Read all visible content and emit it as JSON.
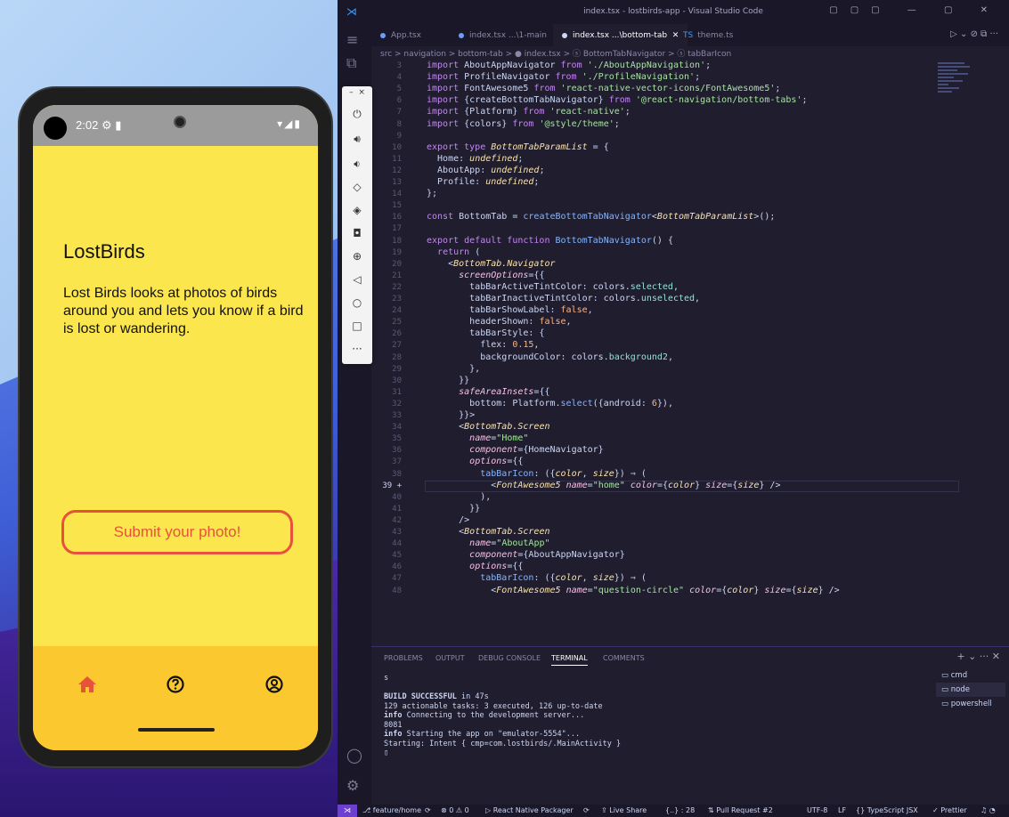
{
  "phone": {
    "status_time": "2:02",
    "status_icons": "⚙ ▮",
    "status_right": "▾◢▮",
    "app_title": "LostBirds",
    "app_description": "Lost Birds looks at photos of birds around you and lets you know if a bird is lost or wandering.",
    "submit_label": "Submit your photo!",
    "colors": {
      "background": "#fbe64d",
      "tabbar": "#fbc82f",
      "accent": "#e8513a"
    },
    "tabs": [
      {
        "icon": "home-icon",
        "active": true
      },
      {
        "icon": "question-circle-icon",
        "active": false
      },
      {
        "icon": "user-circle-icon",
        "active": false
      }
    ]
  },
  "vscode": {
    "window_title": "index.tsx - lostbirds-app - Visual Studio Code",
    "tabs": [
      {
        "label": "App.tsx"
      },
      {
        "label": "index.tsx ...\\1-main"
      },
      {
        "label": "index.tsx ...\\bottom-tab",
        "active": true
      },
      {
        "label": "theme.ts"
      }
    ],
    "breadcrumb": "src > navigation > bottom-tab > ● index.tsx > ⓢ BottomTabNavigator > ⓢ tabBarIcon",
    "code_lines": [
      {
        "n": "3",
        "html": "<span class='k'>import</span> AboutAppNavigator <span class='k'>from</span> <span class='s'>'./AboutAppNavigation'</span>;"
      },
      {
        "n": "4",
        "html": "<span class='k'>import</span> ProfileNavigator <span class='k'>from</span> <span class='s'>'./ProfileNavigation'</span>;"
      },
      {
        "n": "5",
        "html": "<span class='k'>import</span> FontAwesome5 <span class='k'>from</span> <span class='s'>'react-native-vector-icons/FontAwesome5'</span>;"
      },
      {
        "n": "6",
        "html": "<span class='k'>import</span> {createBottomTabNavigator} <span class='k'>from</span> <span class='s'>'@react-navigation/bottom-tabs'</span>;"
      },
      {
        "n": "7",
        "html": "<span class='k'>import</span> {Platform} <span class='k'>from</span> <span class='s'>'react-native'</span>;"
      },
      {
        "n": "8",
        "html": "<span class='k'>import</span> {colors} <span class='k'>from</span> <span class='s'>'@style/theme'</span>;"
      },
      {
        "n": "9",
        "html": ""
      },
      {
        "n": "10",
        "html": "<span class='k'>export type</span> <span class='t'>BottomTabParamList</span> = {"
      },
      {
        "n": "11",
        "html": "  Home: <span class='t'>undefined</span>;"
      },
      {
        "n": "12",
        "html": "  AboutApp: <span class='t'>undefined</span>;"
      },
      {
        "n": "13",
        "html": "  Profile: <span class='t'>undefined</span>;"
      },
      {
        "n": "14",
        "html": "};"
      },
      {
        "n": "15",
        "html": ""
      },
      {
        "n": "16",
        "html": "<span class='k'>const</span> BottomTab = <span class='f'>createBottomTabNavigator</span>&lt;<span class='t'>BottomTabParamList</span>&gt;();"
      },
      {
        "n": "17",
        "html": ""
      },
      {
        "n": "18",
        "html": "<span class='k'>export default function</span> <span class='f'>BottomTabNavigator</span>() {"
      },
      {
        "n": "19",
        "html": "  <span class='k'>return</span> ("
      },
      {
        "n": "20",
        "html": "    &lt;<span class='t'>BottomTab.Navigator</span>"
      },
      {
        "n": "21",
        "html": "      <span class='a'>screenOptions</span>={{"
      },
      {
        "n": "22",
        "html": "        tabBarActiveTintColor: colors.<span class='c'>selected</span>,"
      },
      {
        "n": "23",
        "html": "        tabBarInactiveTintColor: colors.<span class='c'>unselected</span>,"
      },
      {
        "n": "24",
        "html": "        tabBarShowLabel: <span class='n'>false</span>,"
      },
      {
        "n": "25",
        "html": "        headerShown: <span class='n'>false</span>,"
      },
      {
        "n": "26",
        "html": "        tabBarStyle: {"
      },
      {
        "n": "27",
        "html": "          flex: <span class='n'>0.15</span>,"
      },
      {
        "n": "28",
        "html": "          backgroundColor: colors.<span class='c'>background2</span>,"
      },
      {
        "n": "29",
        "html": "        },"
      },
      {
        "n": "30",
        "html": "      }}"
      },
      {
        "n": "31",
        "html": "      <span class='a'>safeAreaInsets</span>={{"
      },
      {
        "n": "32",
        "html": "        bottom: Platform.<span class='f'>select</span>({android: <span class='n'>6</span>}),"
      },
      {
        "n": "33",
        "html": "      }}&gt;"
      },
      {
        "n": "34",
        "html": "      &lt;<span class='t'>BottomTab.Screen</span>"
      },
      {
        "n": "35",
        "html": "        <span class='a'>name</span>=<span class='s'>\"Home\"</span>"
      },
      {
        "n": "36",
        "html": "        <span class='a'>component</span>={HomeNavigator}"
      },
      {
        "n": "37",
        "html": "        <span class='a'>options</span>={{"
      },
      {
        "n": "38",
        "html": "          <span class='f'>tabBarIcon</span>: ({<span class='t'>color</span>, <span class='t'>size</span>}) ⇒ ("
      },
      {
        "n": "39 +",
        "html": "            &lt;<span class='t'>FontAwesome5</span> <span class='a'>name</span>=<span class='s'>\"home\"</span> <span class='a'>color</span>={<span class='t'>color</span>} <span class='a'>size</span>={<span class='t'>size</span>} /&gt;",
        "active": true
      },
      {
        "n": "40",
        "html": "          ),"
      },
      {
        "n": "41",
        "html": "        }}"
      },
      {
        "n": "42",
        "html": "      /&gt;"
      },
      {
        "n": "43",
        "html": "      &lt;<span class='t'>BottomTab.Screen</span>"
      },
      {
        "n": "44",
        "html": "        <span class='a'>name</span>=<span class='s'>\"AboutApp\"</span>"
      },
      {
        "n": "45",
        "html": "        <span class='a'>component</span>={AboutAppNavigator}"
      },
      {
        "n": "46",
        "html": "        <span class='a'>options</span>={{"
      },
      {
        "n": "47",
        "html": "          <span class='f'>tabBarIcon</span>: ({<span class='t'>color</span>, <span class='t'>size</span>}) ⇒ ("
      },
      {
        "n": "48",
        "html": "            &lt;<span class='t'>FontAwesome5</span> <span class='a'>name</span>=<span class='s'>\"question-circle\"</span> <span class='a'>color</span>={<span class='t'>color</span>} <span class='a'>size</span>={<span class='t'>size</span>} /&gt;"
      }
    ],
    "panel_tabs": [
      "PROBLEMS",
      "OUTPUT",
      "DEBUG CONSOLE",
      "TERMINAL",
      "COMMENTS"
    ],
    "active_panel_tab": "TERMINAL",
    "terminal_lines": [
      "s",
      "",
      "<b>BUILD SUCCESSFUL</b> in 47s",
      "129 actionable tasks: 3 executed, 126 up-to-date",
      "<b>info</b> Connecting to the development server...",
      "8081",
      "<b>info</b> Starting the app on \"emulator-5554\"...",
      "Starting: Intent { cmp=com.lostbirds/.MainActivity }",
      "▯"
    ],
    "terminals": [
      {
        "label": "cmd"
      },
      {
        "label": "node",
        "active": true
      },
      {
        "label": "powershell"
      }
    ],
    "statusbar": {
      "branch": "feature/home",
      "sync_icon": "⟳",
      "problems": "⊗ 0 ⚠ 0",
      "packager": "▷ React Native Packager",
      "sync2": "⟳",
      "live_share": "Live Share",
      "position": "{..} : 28",
      "pr": "Pull Request #2",
      "encoding": "UTF-8",
      "eol": "LF",
      "language": "{} TypeScript JSX",
      "prettier": "✓ Prettier"
    }
  }
}
